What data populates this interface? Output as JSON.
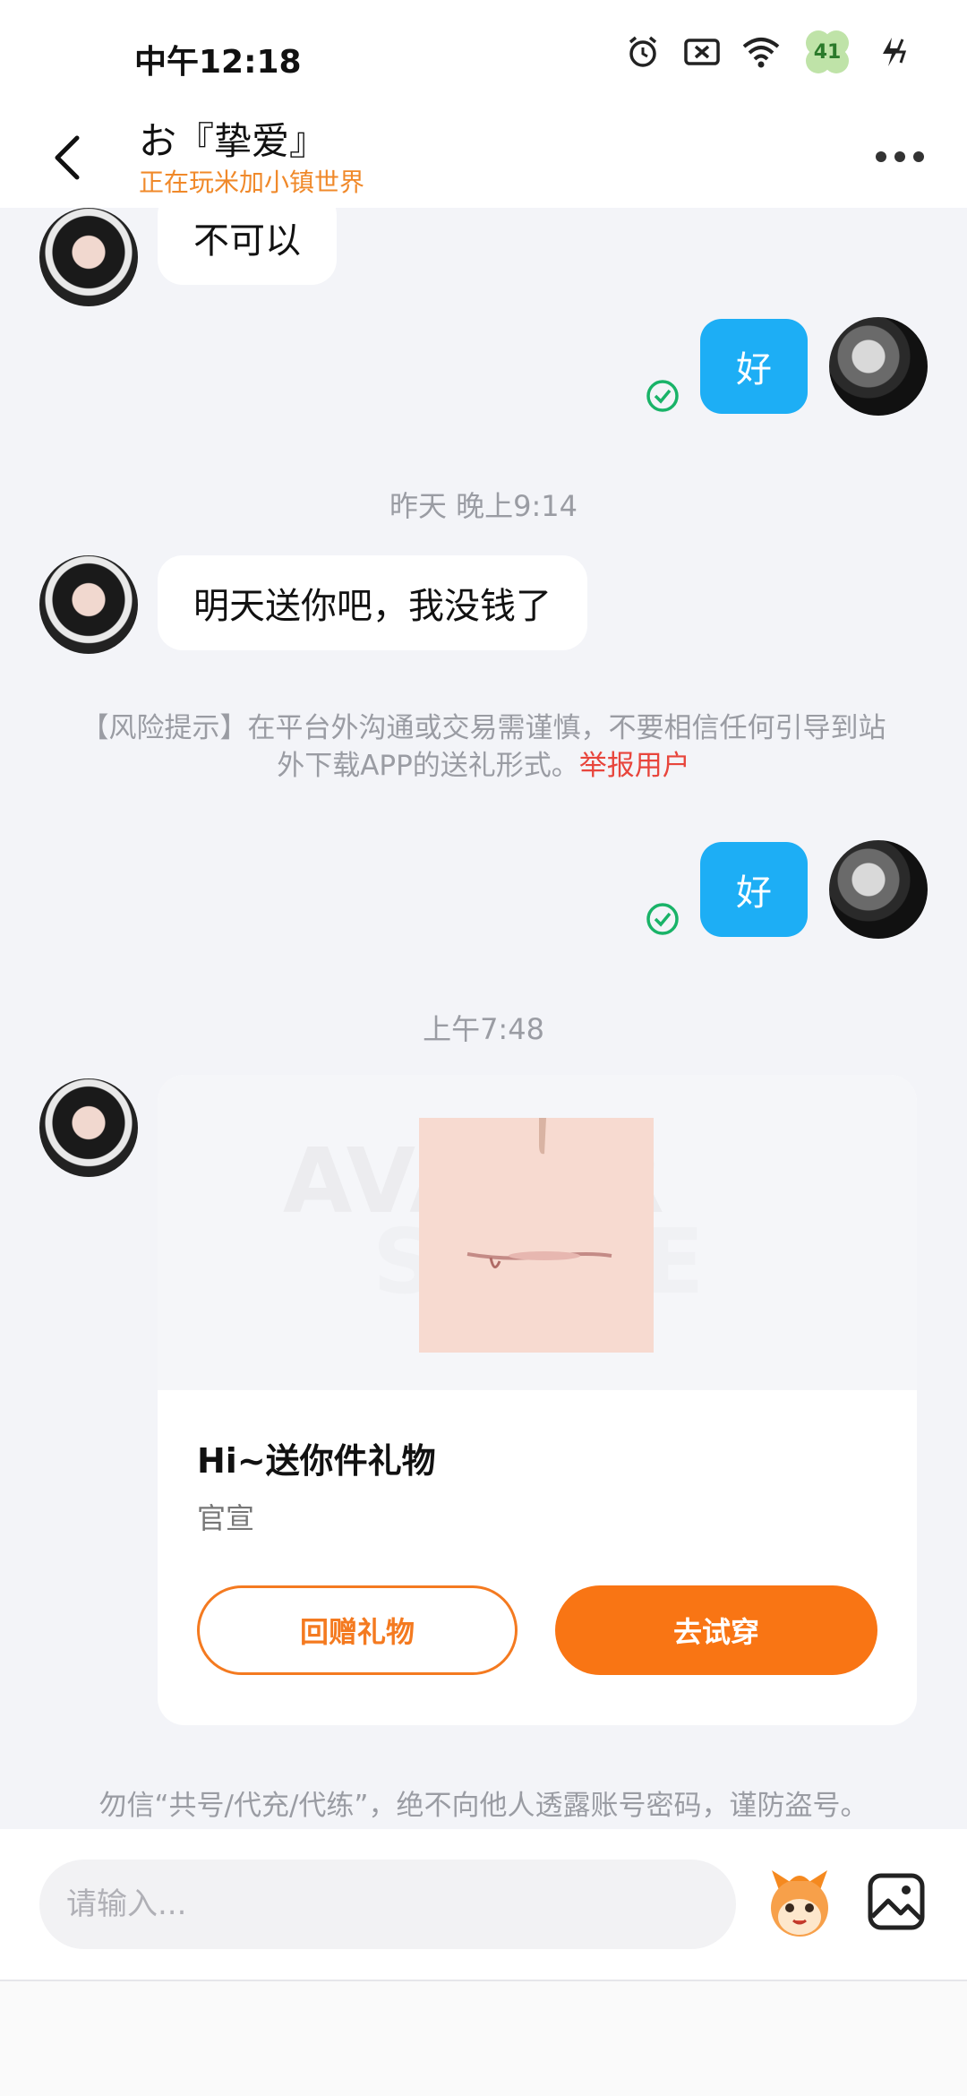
{
  "status_bar": {
    "time": "中午12:18",
    "battery_level": "41",
    "icons": [
      "alarm-icon",
      "no-sim-icon",
      "wifi-icon",
      "battery-icon",
      "charging-icon"
    ]
  },
  "header": {
    "title": "お『挚爱』",
    "subtitle": "正在玩米加小镇世界"
  },
  "messages": [
    {
      "side": "left",
      "text": "不可以"
    },
    {
      "side": "right",
      "text": "好"
    },
    {
      "type": "time",
      "text": "昨天 晚上9:14"
    },
    {
      "side": "left",
      "text": "明天送你吧，我没钱了"
    },
    {
      "type": "notice",
      "text": "【风险提示】在平台外沟通或交易需谨慎，不要相信任何引导到站外下载APP的送礼形式。",
      "link": "举报用户"
    },
    {
      "side": "right",
      "text": "好"
    },
    {
      "type": "time",
      "text": "上午7:48"
    }
  ],
  "gift_card": {
    "watermark_line1": "AVATAR",
    "watermark_line2": "STORE",
    "title": "Hi~送你件礼物",
    "subtitle": "官宣",
    "return_gift_label": "回赠礼物",
    "try_on_label": "去试穿"
  },
  "bottom_notice": "勿信“共号/代充/代练”，绝不向他人透露账号密码，谨防盗号。",
  "input": {
    "placeholder": "请输入..."
  },
  "colors": {
    "accent_orange": "#f97514",
    "bubble_blue": "#1daef5",
    "subtitle_orange": "#f0892a",
    "report_red": "#e8453c",
    "read_green": "#19b368"
  }
}
